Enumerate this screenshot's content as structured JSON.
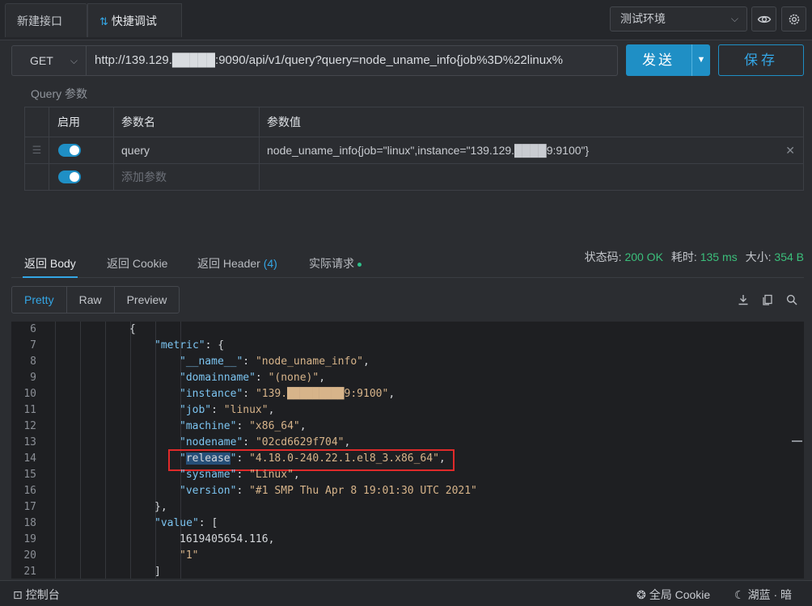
{
  "tabs": [
    {
      "label": "新建接口"
    },
    {
      "label": "快捷调试",
      "close": "✕"
    }
  ],
  "env": {
    "selected": "测试环境"
  },
  "request": {
    "method": "GET",
    "url": "http://139.129.█████:9090/api/v1/query?query=node_uname_info{job%3D%22linux%",
    "send_label": "发送",
    "save_label": "保存"
  },
  "query": {
    "title": "Query 参数",
    "headers": {
      "enabled": "启用",
      "name": "参数名",
      "value": "参数值"
    },
    "rows": [
      {
        "name": "query",
        "value": "node_uname_info{job=\"linux\",instance=\"139.129.████9:9100\"}",
        "enabled": true
      }
    ],
    "add_placeholder": "添加参数"
  },
  "response": {
    "tabs": [
      {
        "label": "返回 Body"
      },
      {
        "label": "返回 Cookie"
      },
      {
        "label": "返回 Header",
        "count": "(4)"
      },
      {
        "label": "实际请求"
      }
    ],
    "status_label": "状态码:",
    "status_value": "200 OK",
    "time_label": "耗时:",
    "time_value": "135 ms",
    "size_label": "大小:",
    "size_value": "354 B",
    "formats": [
      "Pretty",
      "Raw",
      "Preview"
    ]
  },
  "code_lines": [
    {
      "n": "6",
      "indent": 0,
      "parts": [
        [
          "n",
          "{"
        ]
      ]
    },
    {
      "n": "7",
      "indent": 1,
      "parts": [
        [
          "k",
          "\"metric\""
        ],
        [
          "n",
          ": {"
        ]
      ]
    },
    {
      "n": "8",
      "indent": 2,
      "parts": [
        [
          "k",
          "\"__name__\""
        ],
        [
          "n",
          ": "
        ],
        [
          "s",
          "\"node_uname_info\""
        ],
        [
          "n",
          ","
        ]
      ]
    },
    {
      "n": "9",
      "indent": 2,
      "parts": [
        [
          "k",
          "\"domainname\""
        ],
        [
          "n",
          ": "
        ],
        [
          "s",
          "\"(none)\""
        ],
        [
          "n",
          ","
        ]
      ]
    },
    {
      "n": "10",
      "indent": 2,
      "parts": [
        [
          "k",
          "\"instance\""
        ],
        [
          "n",
          ": "
        ],
        [
          "s",
          "\"139.█████████9:9100\""
        ],
        [
          "n",
          ","
        ]
      ]
    },
    {
      "n": "11",
      "indent": 2,
      "parts": [
        [
          "k",
          "\"job\""
        ],
        [
          "n",
          ": "
        ],
        [
          "s",
          "\"linux\""
        ],
        [
          "n",
          ","
        ]
      ]
    },
    {
      "n": "12",
      "indent": 2,
      "parts": [
        [
          "k",
          "\"machine\""
        ],
        [
          "n",
          ": "
        ],
        [
          "s",
          "\"x86_64\""
        ],
        [
          "n",
          ","
        ]
      ]
    },
    {
      "n": "13",
      "indent": 2,
      "parts": [
        [
          "k",
          "\"nodename\""
        ],
        [
          "n",
          ": "
        ],
        [
          "s",
          "\"02cd6629f704\""
        ],
        [
          "n",
          ","
        ]
      ]
    },
    {
      "n": "14",
      "indent": 2,
      "parts": [
        [
          "k",
          "\""
        ],
        [
          "hl",
          "release"
        ],
        [
          "k",
          "\""
        ],
        [
          "n",
          ": "
        ],
        [
          "s",
          "\"4.18.0-240.22.1.el8_3.x86_64\""
        ],
        [
          "n",
          ","
        ]
      ]
    },
    {
      "n": "15",
      "indent": 2,
      "parts": [
        [
          "k",
          "\"sysname\""
        ],
        [
          "n",
          ": "
        ],
        [
          "s",
          "\"Linux\""
        ],
        [
          "n",
          ","
        ]
      ]
    },
    {
      "n": "16",
      "indent": 2,
      "parts": [
        [
          "k",
          "\"version\""
        ],
        [
          "n",
          ": "
        ],
        [
          "s",
          "\"#1 SMP Thu Apr 8 19:01:30 UTC 2021\""
        ]
      ]
    },
    {
      "n": "17",
      "indent": 1,
      "parts": [
        [
          "n",
          "},"
        ]
      ]
    },
    {
      "n": "18",
      "indent": 1,
      "parts": [
        [
          "k",
          "\"value\""
        ],
        [
          "n",
          ": ["
        ]
      ]
    },
    {
      "n": "19",
      "indent": 2,
      "parts": [
        [
          "n",
          "1619405654.116,"
        ]
      ]
    },
    {
      "n": "20",
      "indent": 2,
      "parts": [
        [
          "s",
          "\"1\""
        ]
      ]
    },
    {
      "n": "21",
      "indent": 1,
      "parts": [
        [
          "n",
          "]"
        ]
      ]
    }
  ],
  "footer": {
    "console": "控制台",
    "cookie": "全局 Cookie",
    "theme": "湖蓝 · 暗"
  },
  "colors": {
    "accent": "#1f8fc5",
    "success": "#3bbf7b",
    "highlight_box": "#e02a2a"
  }
}
